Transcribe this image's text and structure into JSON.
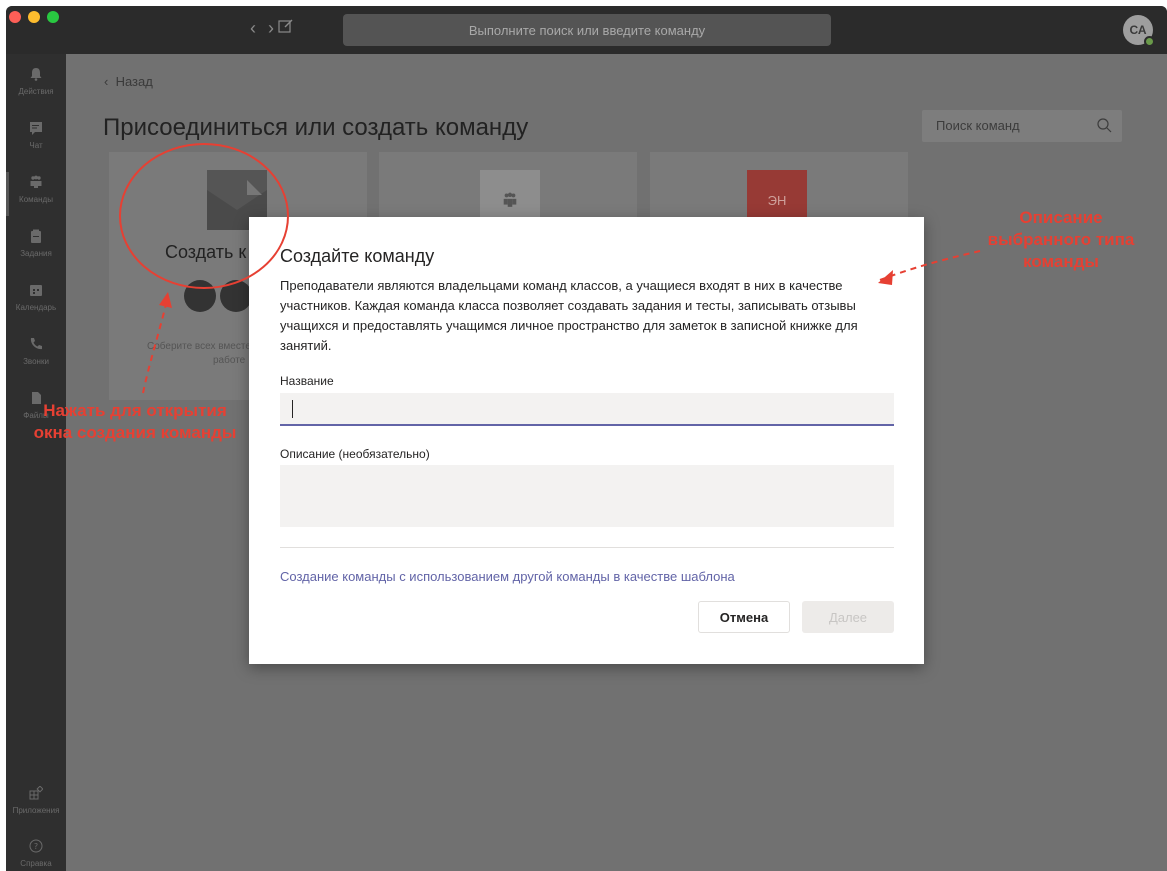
{
  "titlebar": {
    "search_placeholder": "Выполните поиск или введите команду",
    "avatar_initials": "СА"
  },
  "rail": {
    "items": [
      {
        "label": "Действия",
        "icon": "bell-icon"
      },
      {
        "label": "Чат",
        "icon": "chat-icon"
      },
      {
        "label": "Команды",
        "icon": "teams-icon"
      },
      {
        "label": "Задания",
        "icon": "assignments-icon"
      },
      {
        "label": "Календарь",
        "icon": "calendar-icon"
      },
      {
        "label": "Звонки",
        "icon": "phone-icon"
      },
      {
        "label": "Файлы",
        "icon": "files-icon"
      }
    ],
    "bottom_items": [
      {
        "label": "Приложения",
        "icon": "apps-icon"
      },
      {
        "label": "Справка",
        "icon": "help-icon"
      }
    ]
  },
  "main": {
    "back_label": "Назад",
    "page_title": "Присоединиться или создать команду",
    "team_search_placeholder": "Поиск команд",
    "cards": [
      {
        "title": "Создать к",
        "desc": "Соберите всех вместе",
        "desc2": "работе"
      },
      {
        "badge": ""
      },
      {
        "badge": "ЭН"
      }
    ]
  },
  "modal": {
    "title": "Создайте команду",
    "description": "Преподаватели являются владельцами команд классов, а учащиеся входят в них в качестве участников. Каждая команда класса позволяет создавать задания и тесты, записывать отзывы учащихся и предоставлять учащимся личное пространство для заметок в записной книжке для занятий.",
    "name_label": "Название",
    "name_value": "",
    "desc_label": "Описание (необязательно)",
    "desc_value": "",
    "template_link": "Создание команды с использованием другой команды в качестве шаблона",
    "cancel_label": "Отмена",
    "next_label": "Далее"
  },
  "annotations": {
    "left": "Нажать для открытия окна создания команды",
    "right": "Описание выбранного типа команды"
  },
  "colors": {
    "accent": "#6264a7",
    "annotation": "#e64033"
  }
}
